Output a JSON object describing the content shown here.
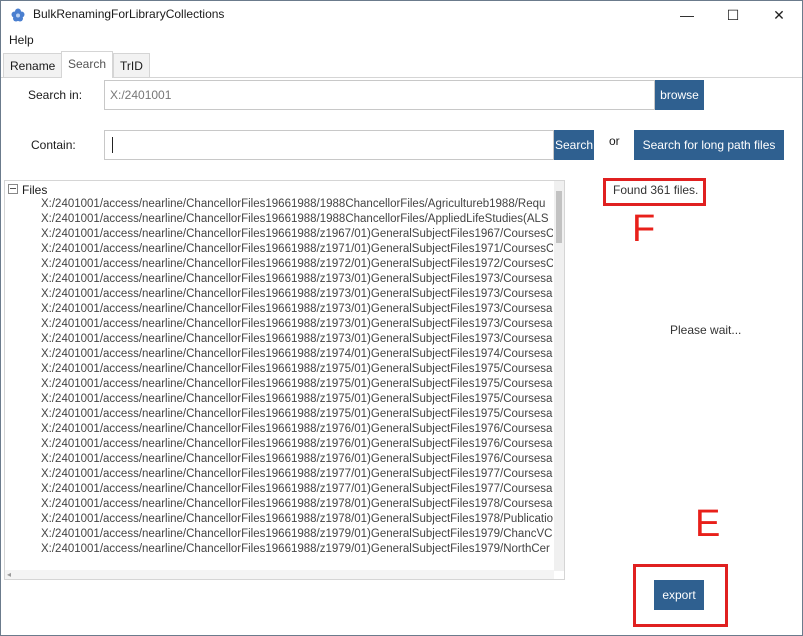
{
  "window": {
    "title": "BulkRenamingForLibraryCollections",
    "minimize": "—",
    "maximize": "☐",
    "close": "✕"
  },
  "menu": {
    "help": "Help"
  },
  "tabs": [
    {
      "label": "Rename"
    },
    {
      "label": "Search"
    },
    {
      "label": "TrID"
    }
  ],
  "search_in": {
    "label": "Search in:",
    "value": "X:/2401001",
    "browse_label": "browse"
  },
  "contain": {
    "label": "Contain:",
    "value": "",
    "search_label": "Search",
    "or_label": "or",
    "long_path_label": "Search for long path files"
  },
  "files_tree": {
    "header": "Files",
    "items": [
      "X:/2401001/access/nearline/ChancellorFiles19661988/1988ChancellorFiles/Agricultureb1988/Requ",
      "X:/2401001/access/nearline/ChancellorFiles19661988/1988ChancellorFiles/AppliedLifeStudies(ALS",
      "X:/2401001/access/nearline/ChancellorFiles19661988/z1967/01)GeneralSubjectFiles1967/CoursesC",
      "X:/2401001/access/nearline/ChancellorFiles19661988/z1971/01)GeneralSubjectFiles1971/CoursesC",
      "X:/2401001/access/nearline/ChancellorFiles19661988/z1972/01)GeneralSubjectFiles1972/CoursesC",
      "X:/2401001/access/nearline/ChancellorFiles19661988/z1973/01)GeneralSubjectFiles1973/Coursesa",
      "X:/2401001/access/nearline/ChancellorFiles19661988/z1973/01)GeneralSubjectFiles1973/Coursesa",
      "X:/2401001/access/nearline/ChancellorFiles19661988/z1973/01)GeneralSubjectFiles1973/Coursesa",
      "X:/2401001/access/nearline/ChancellorFiles19661988/z1973/01)GeneralSubjectFiles1973/Coursesa",
      "X:/2401001/access/nearline/ChancellorFiles19661988/z1973/01)GeneralSubjectFiles1973/Coursesa",
      "X:/2401001/access/nearline/ChancellorFiles19661988/z1974/01)GeneralSubjectFiles1974/Coursesa",
      "X:/2401001/access/nearline/ChancellorFiles19661988/z1975/01)GeneralSubjectFiles1975/Coursesa",
      "X:/2401001/access/nearline/ChancellorFiles19661988/z1975/01)GeneralSubjectFiles1975/Coursesa",
      "X:/2401001/access/nearline/ChancellorFiles19661988/z1975/01)GeneralSubjectFiles1975/Coursesa",
      "X:/2401001/access/nearline/ChancellorFiles19661988/z1975/01)GeneralSubjectFiles1975/Coursesa",
      "X:/2401001/access/nearline/ChancellorFiles19661988/z1976/01)GeneralSubjectFiles1976/Coursesa",
      "X:/2401001/access/nearline/ChancellorFiles19661988/z1976/01)GeneralSubjectFiles1976/Coursesa",
      "X:/2401001/access/nearline/ChancellorFiles19661988/z1976/01)GeneralSubjectFiles1976/Coursesa",
      "X:/2401001/access/nearline/ChancellorFiles19661988/z1977/01)GeneralSubjectFiles1977/Coursesa",
      "X:/2401001/access/nearline/ChancellorFiles19661988/z1977/01)GeneralSubjectFiles1977/Coursesa",
      "X:/2401001/access/nearline/ChancellorFiles19661988/z1978/01)GeneralSubjectFiles1978/Coursesa",
      "X:/2401001/access/nearline/ChancellorFiles19661988/z1978/01)GeneralSubjectFiles1978/Publicatio",
      "X:/2401001/access/nearline/ChancellorFiles19661988/z1979/01)GeneralSubjectFiles1979/ChancVC",
      "X:/2401001/access/nearline/ChancellorFiles19661988/z1979/01)GeneralSubjectFiles1979/NorthCer"
    ]
  },
  "status": {
    "found": "Found 361 files.",
    "wait": "Please wait..."
  },
  "annotations": {
    "letter_f": "F",
    "letter_e": "E"
  },
  "export_label": "export",
  "colors": {
    "accent": "#2f6090",
    "annotation": "#e02020"
  }
}
